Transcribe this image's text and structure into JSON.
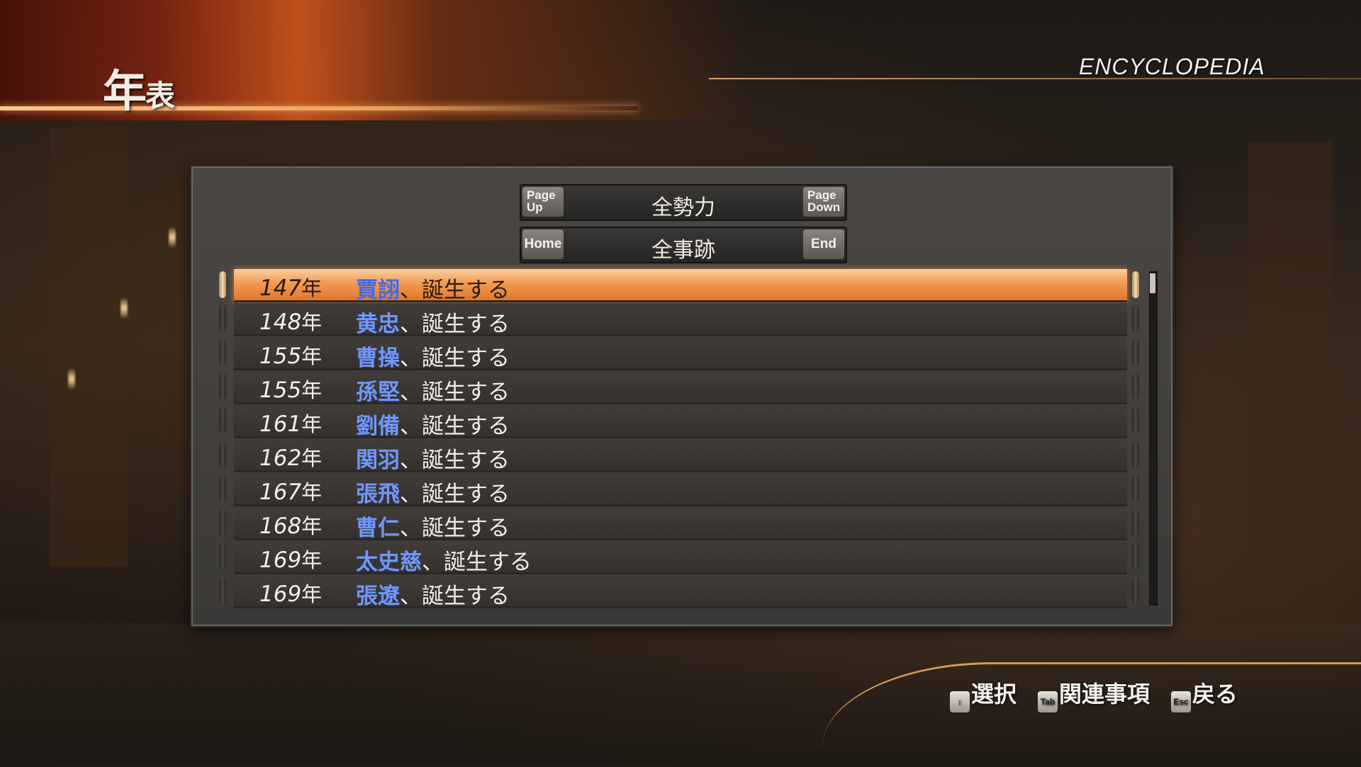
{
  "header": {
    "title_main": "年",
    "title_small": "表",
    "section_label": "ENCYCLOPEDIA"
  },
  "filters": {
    "faction": {
      "label": "全勢力",
      "prev_key": "Page Up",
      "next_key": "Page Down"
    },
    "event_type": {
      "label": "全事跡",
      "prev_key": "Home",
      "next_key": "End"
    }
  },
  "timeline": {
    "year_suffix": "年",
    "selected_index": 0,
    "entries": [
      {
        "year": "147",
        "name": "賈詡",
        "text": "、誕生する"
      },
      {
        "year": "148",
        "name": "黄忠",
        "text": "、誕生する"
      },
      {
        "year": "155",
        "name": "曹操",
        "text": "、誕生する"
      },
      {
        "year": "155",
        "name": "孫堅",
        "text": "、誕生する"
      },
      {
        "year": "161",
        "name": "劉備",
        "text": "、誕生する"
      },
      {
        "year": "162",
        "name": "関羽",
        "text": "、誕生する"
      },
      {
        "year": "167",
        "name": "張飛",
        "text": "、誕生する"
      },
      {
        "year": "168",
        "name": "曹仁",
        "text": "、誕生する"
      },
      {
        "year": "169",
        "name": "太史慈",
        "text": "、誕生する"
      },
      {
        "year": "169",
        "name": "張遼",
        "text": "、誕生する"
      }
    ]
  },
  "hints": [
    {
      "key": "↕",
      "label": "選択"
    },
    {
      "key": "Tab",
      "label": "関連事項"
    },
    {
      "key": "Esc",
      "label": "戻る"
    }
  ],
  "colors": {
    "highlight": "#f29a52",
    "name_blue": "#6f97ff",
    "panel": "#3c3a38"
  }
}
